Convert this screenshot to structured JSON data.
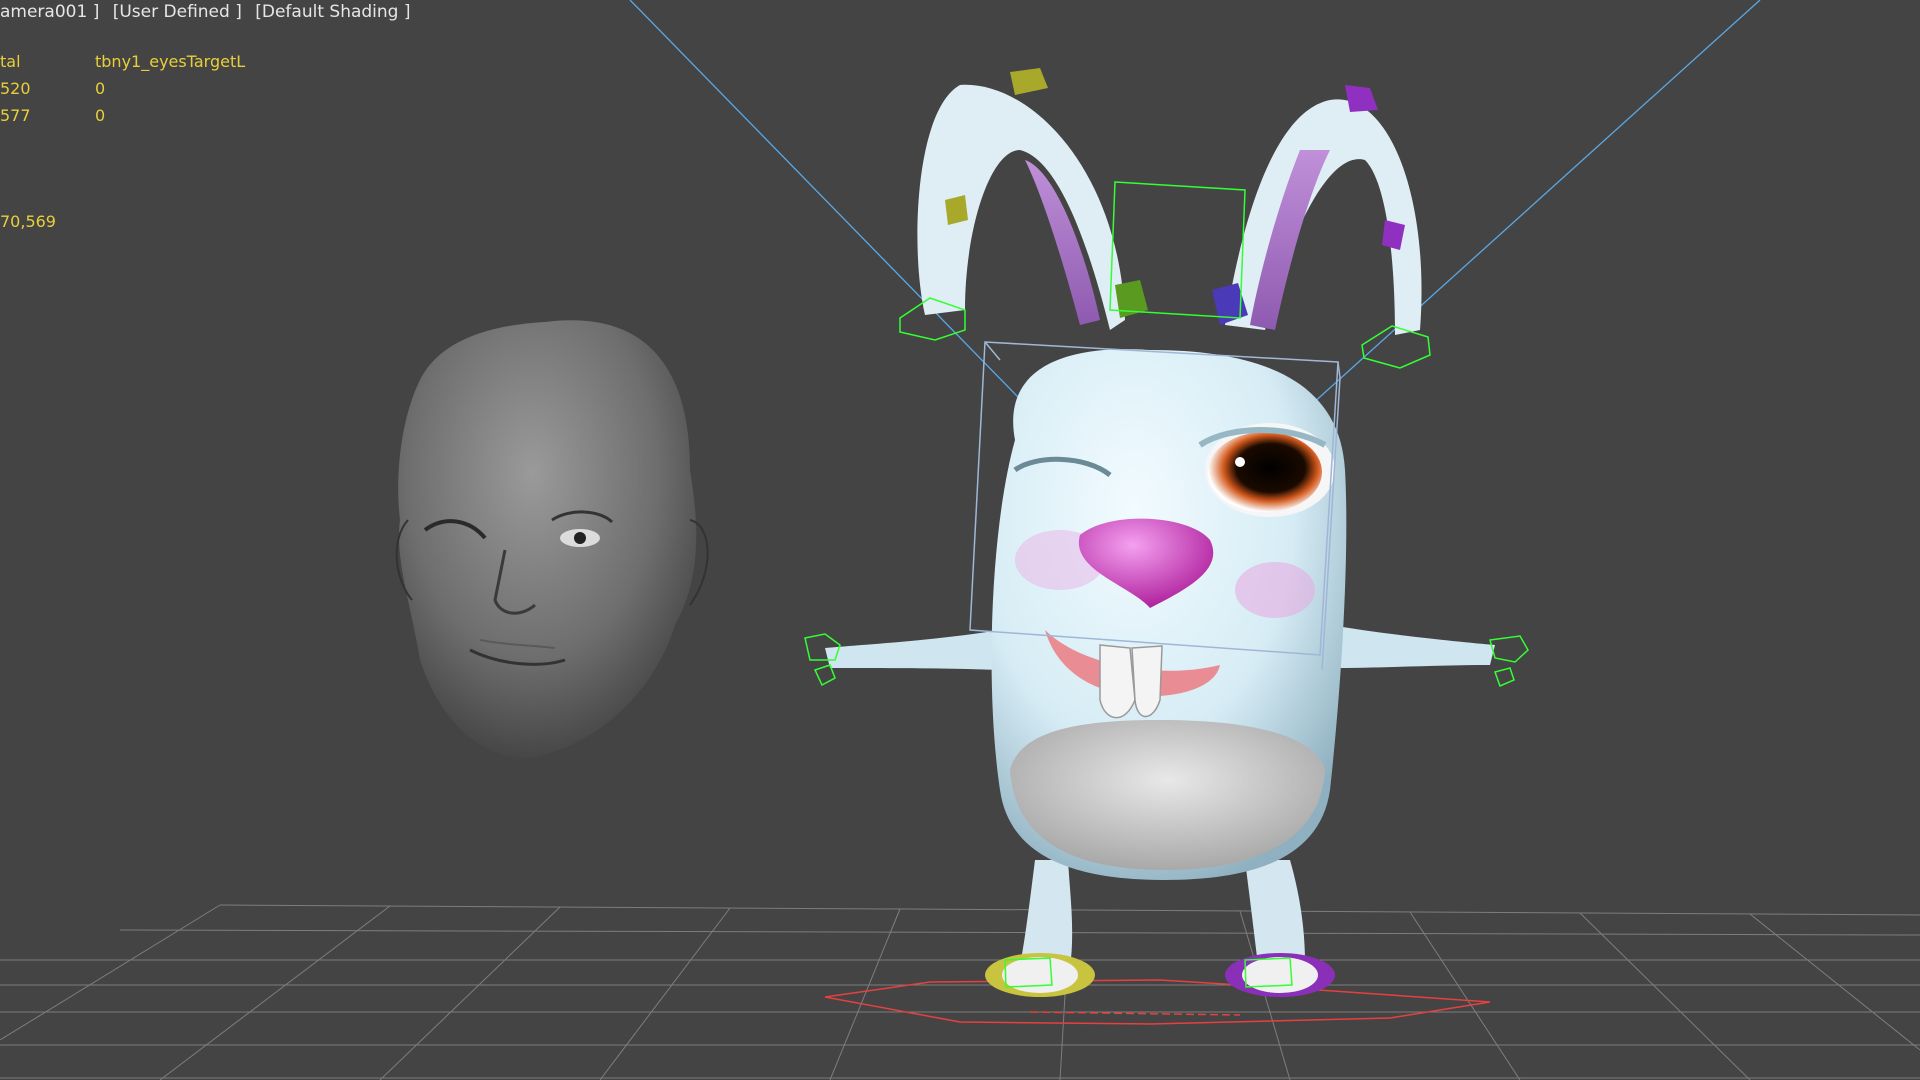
{
  "viewport": {
    "labels": [
      "amera001 ]",
      "[User Defined ]",
      "[Default Shading ]"
    ],
    "stats": {
      "header": [
        "tal",
        "tbny1_eyesTargetL"
      ],
      "rows": [
        [
          "520",
          "0"
        ],
        [
          "577",
          "0"
        ]
      ],
      "total": "70,569"
    }
  },
  "colors": {
    "background": "#444444",
    "stats_text": "#e8cf3a",
    "label_text": "#e6e6e6",
    "control_green": "#33ff33",
    "camera_line": "#5aa8e6",
    "grid": "#8a8a8a",
    "root_red": "#e64040"
  },
  "scene_objects": [
    "grid-floor",
    "human-head-mesh",
    "bunny-character-rig",
    "camera-target-lines"
  ]
}
